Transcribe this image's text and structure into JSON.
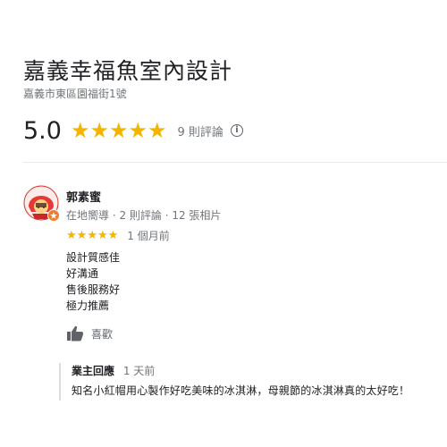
{
  "place": {
    "title": "嘉義幸福魚室內設計",
    "address": "嘉義市東區園福街1號",
    "rating": "5.0",
    "stars": "★★★★★",
    "review_count": "9 則評論",
    "info_icon": "i"
  },
  "review": {
    "reviewer_name": "郭素蜜",
    "reviewer_meta": "在地嚮導 · 2 則評論 · 12 張相片",
    "stars": "★★★★★",
    "rating_value": 5,
    "time": "1 個月前",
    "lines": [
      "設計質感佳",
      "好溝通",
      "售後服務好",
      "極力推薦"
    ],
    "like_label": "喜歡"
  },
  "owner_reply": {
    "label": "業主回應",
    "time": "1 天前",
    "text": "知名小紅帽用心製作好吃美味的冰淇淋，母親節的冰淇淋真的太好吃！"
  },
  "icons": {
    "avatar": "red-hood-avatar-icon",
    "local_guide_badge": "local-guide-badge-icon",
    "like": "thumbs-up-icon",
    "info": "info-icon"
  },
  "colors": {
    "star": "#f4b400",
    "muted": "#70757a",
    "text": "#202124",
    "badge": "#f37a26"
  }
}
